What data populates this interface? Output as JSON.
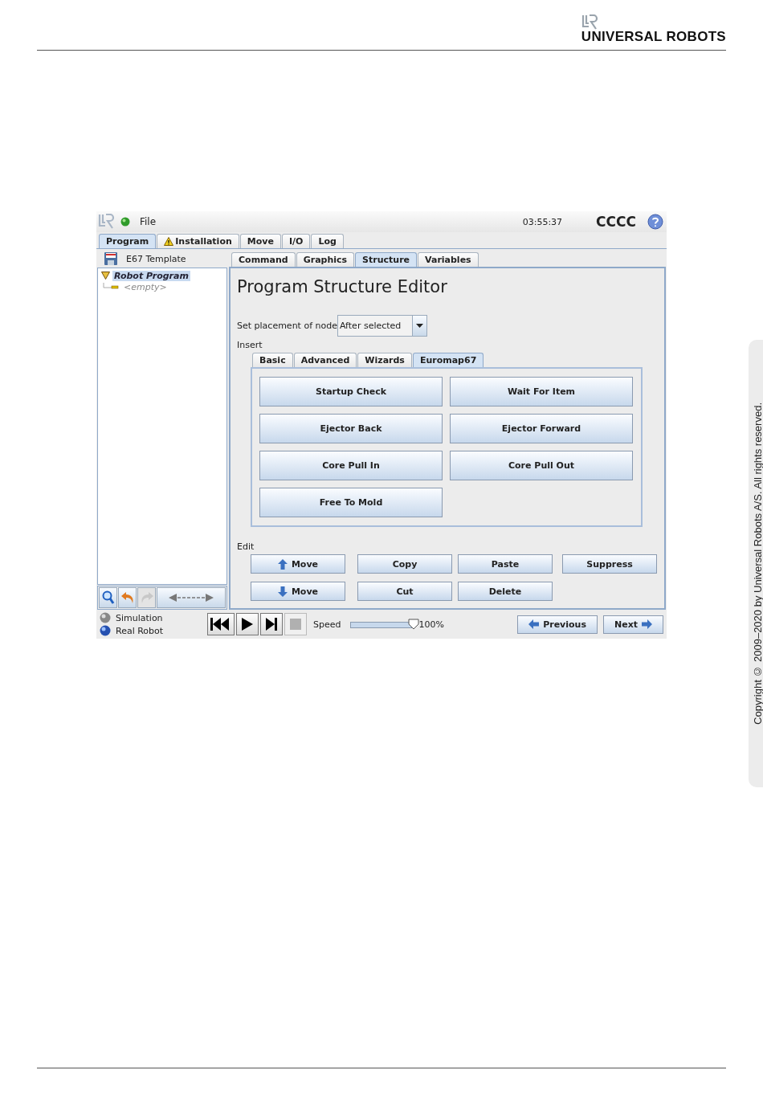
{
  "page_header": {
    "logo_text": "UNIVERSAL ROBOTS"
  },
  "side_note": "Copyright © 2009–2020 by Universal Robots A/S. All rights reserved.",
  "window": {
    "menu": "File",
    "time": "03:55:37",
    "robot_name": "CCCC"
  },
  "main_tabs": [
    {
      "label": "Program",
      "selected": true,
      "warning": false
    },
    {
      "label": "Installation",
      "selected": false,
      "warning": true
    },
    {
      "label": "Move",
      "selected": false,
      "warning": false
    },
    {
      "label": "I/O",
      "selected": false,
      "warning": false
    },
    {
      "label": "Log",
      "selected": false,
      "warning": false
    }
  ],
  "program_panel": {
    "file_name": "E67 Template",
    "tree": [
      {
        "label": "Robot Program",
        "selected": true,
        "expanded": true,
        "children": [
          {
            "label": "<empty>",
            "selected": false
          }
        ]
      }
    ],
    "toolbar": [
      {
        "kind": "search",
        "disabled": false
      },
      {
        "kind": "undo",
        "disabled": false
      },
      {
        "kind": "redo",
        "disabled": true
      },
      {
        "kind": "expand",
        "disabled": false
      }
    ]
  },
  "sub_tabs": [
    {
      "label": "Command",
      "selected": false
    },
    {
      "label": "Graphics",
      "selected": false
    },
    {
      "label": "Structure",
      "selected": true
    },
    {
      "label": "Variables",
      "selected": false
    }
  ],
  "editor": {
    "title": "Program Structure Editor",
    "placement_label": "Set placement of node",
    "placement_value": "After selected",
    "insert_label": "Insert",
    "insert_tabs": [
      {
        "label": "Basic",
        "selected": false
      },
      {
        "label": "Advanced",
        "selected": false
      },
      {
        "label": "Wizards",
        "selected": false
      },
      {
        "label": "Euromap67",
        "selected": true
      }
    ],
    "insert_buttons": [
      "Startup Check",
      "Wait For Item",
      "Ejector Back",
      "Ejector Forward",
      "Core Pull In",
      "Core Pull Out",
      "Free To Mold"
    ],
    "edit_label": "Edit",
    "edit_buttons": [
      [
        {
          "label": "Move",
          "kind": "up"
        },
        {
          "label": "Copy",
          "kind": "plain"
        },
        {
          "label": "Paste",
          "kind": "plain"
        },
        {
          "label": "Suppress",
          "kind": "plain"
        }
      ],
      [
        {
          "label": "Move",
          "kind": "down"
        },
        {
          "label": "Cut",
          "kind": "plain"
        },
        {
          "label": "Delete",
          "kind": "plain"
        }
      ]
    ]
  },
  "status_bar": {
    "modes": [
      {
        "label": "Simulation",
        "selected": false
      },
      {
        "label": "Real Robot",
        "selected": true
      }
    ],
    "transport": [
      {
        "kind": "rewind",
        "disabled": false
      },
      {
        "kind": "play",
        "disabled": false
      },
      {
        "kind": "step",
        "disabled": false
      },
      {
        "kind": "stop",
        "disabled": true
      }
    ],
    "speed_label": "Speed",
    "speed": {
      "level": 1,
      "reading": "100%"
    },
    "nav_buttons": [
      {
        "label": "Previous",
        "kind": "previous"
      },
      {
        "label": "Next",
        "kind": "next"
      }
    ]
  }
}
